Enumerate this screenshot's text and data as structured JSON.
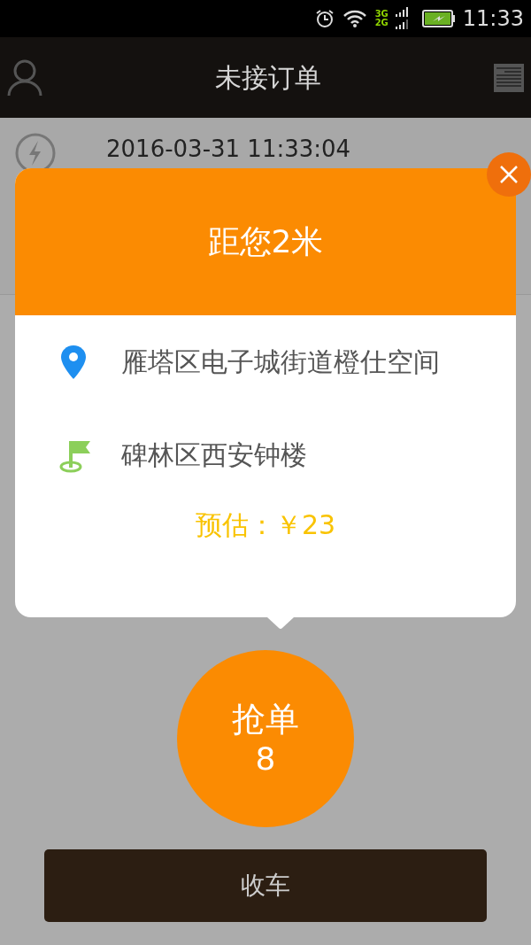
{
  "status_bar": {
    "network_labels": [
      "3G",
      "2G"
    ],
    "time": "11:33"
  },
  "app_bar": {
    "title": "未接订单"
  },
  "order": {
    "time": "2016-03-31 11:33:04"
  },
  "popup": {
    "distance": "距您2米",
    "places": [
      {
        "kind": "origin",
        "text": "雁塔区电子城街道橙仕空间"
      },
      {
        "kind": "destination",
        "text": "碑林区西安钟楼"
      }
    ],
    "estimate": "预估：￥23"
  },
  "grab_button": {
    "label": "抢单",
    "count": "8"
  },
  "bottom_button": {
    "label": "收车"
  }
}
